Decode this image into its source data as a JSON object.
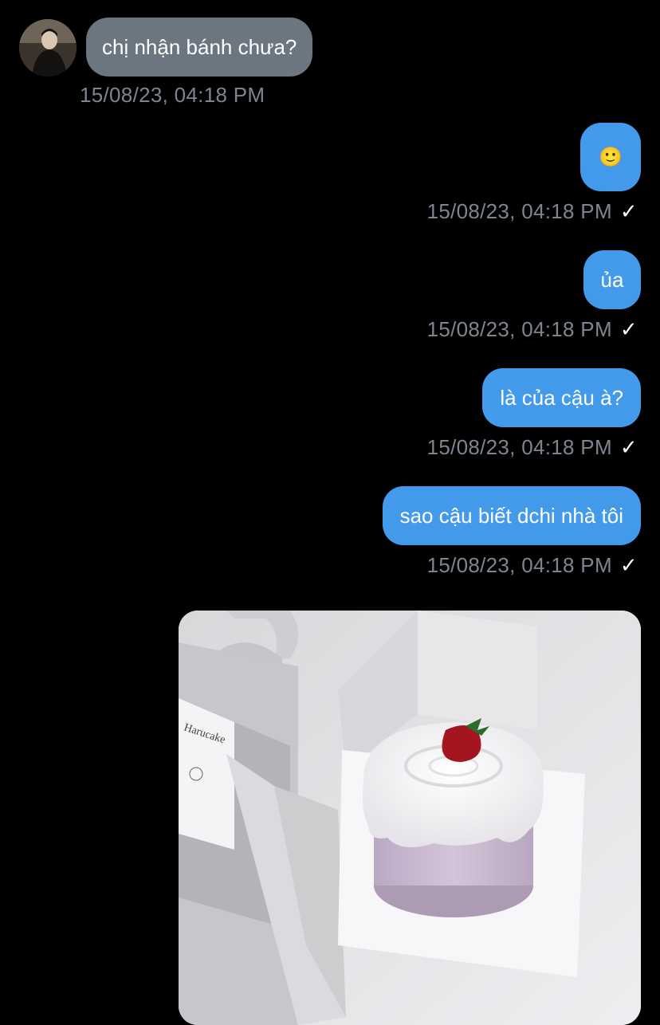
{
  "incoming": {
    "message": "chị nhận bánh chưa?",
    "timestamp": "15/08/23, 04:18 PM"
  },
  "outgoing": [
    {
      "text": "🙂",
      "timestamp": "15/08/23, 04:18 PM",
      "status": "✓"
    },
    {
      "text": "ủa",
      "timestamp": "15/08/23, 04:18 PM",
      "status": "✓"
    },
    {
      "text": "là của cậu à?",
      "timestamp": "15/08/23, 04:18 PM",
      "status": "✓"
    },
    {
      "text": "sao cậu biết dchi nhà tôi",
      "timestamp": "15/08/23, 04:18 PM",
      "status": "✓"
    }
  ],
  "photo": {
    "box_brand": "Harucake"
  },
  "colors": {
    "incoming_bubble": "#6b7680",
    "outgoing_bubble": "#4399ea",
    "timestamp": "#7d8590",
    "background": "#000000"
  }
}
